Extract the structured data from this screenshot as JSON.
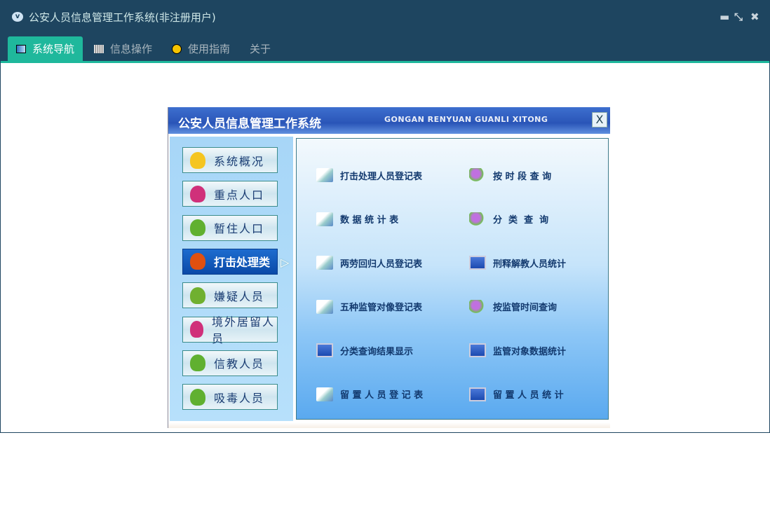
{
  "window": {
    "title": "公安人员信息管理工作系统(非注册用户)",
    "app_icon": "vf-logo-icon"
  },
  "tabs": [
    {
      "label": "系统导航",
      "icon": "monitor-icon"
    },
    {
      "label": "信息操作",
      "icon": "grid-icon"
    },
    {
      "label": "使用指南",
      "icon": "help-icon"
    },
    {
      "label": "关于"
    }
  ],
  "panel": {
    "title": "公安人员信息管理工作系统",
    "subtitle": "GONGAN RENYUAN GUANLI XITONG",
    "close": "X"
  },
  "left_menu": [
    {
      "label": "系统概况",
      "icon": "star-icon"
    },
    {
      "label": "重点人口",
      "icon": "user-pink-icon"
    },
    {
      "label": "暂住人口",
      "icon": "user-clock-icon"
    },
    {
      "label": "打击处理类",
      "icon": "monitor-icon",
      "active": true
    },
    {
      "label": "嫌疑人员",
      "icon": "user-icon"
    },
    {
      "label": "境外居留人员",
      "icon": "user-forbidden-icon"
    },
    {
      "label": "信教人员",
      "icon": "users-icon"
    },
    {
      "label": "吸毒人员",
      "icon": "user-forbidden-icon"
    }
  ],
  "main_items": [
    {
      "label": "打击处理人员登记表",
      "icon": "doc"
    },
    {
      "label": "按 时 段 查 询",
      "icon": "srch"
    },
    {
      "label": "数 据 统 计 表",
      "icon": "doc"
    },
    {
      "label": "分  类  查  询",
      "icon": "srch"
    },
    {
      "label": "两劳回归人员登记表",
      "icon": "doc"
    },
    {
      "label": "刑释解教人员统计",
      "icon": "mon"
    },
    {
      "label": "五种监管对像登记表",
      "icon": "doc"
    },
    {
      "label": "按监管时间查询",
      "icon": "srch"
    },
    {
      "label": "分类查询结果显示",
      "icon": "mon"
    },
    {
      "label": "监管对象数据统计",
      "icon": "mon"
    },
    {
      "label": "留 置 人 员 登 记 表",
      "icon": "doc"
    },
    {
      "label": "留 置 人 员 统 计",
      "icon": "mon"
    }
  ]
}
